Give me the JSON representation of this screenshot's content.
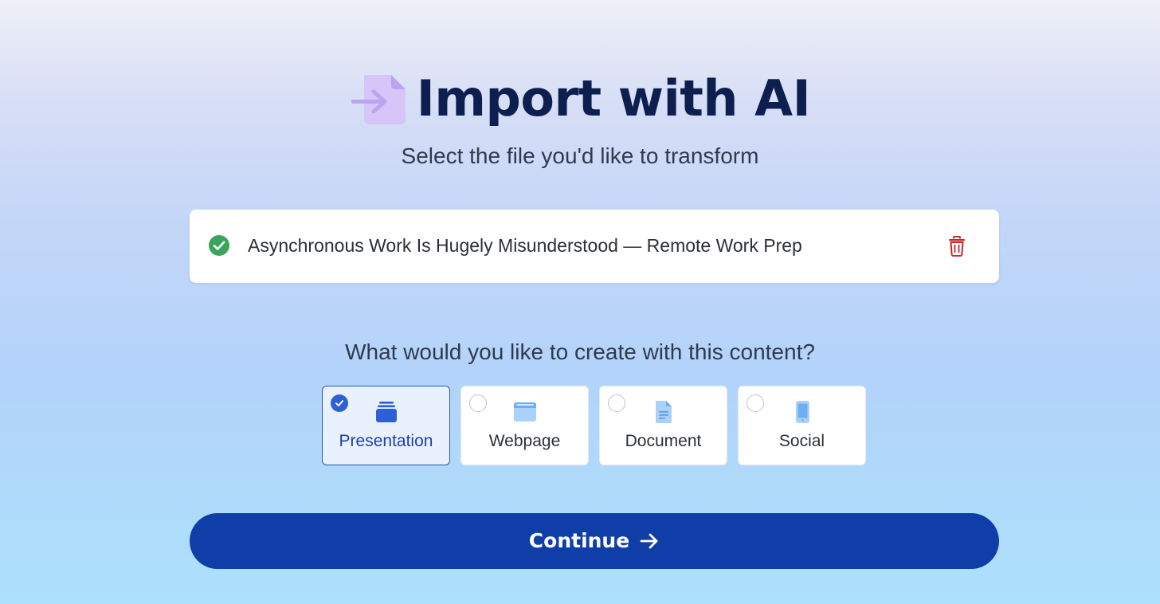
{
  "header": {
    "title": "Import with AI",
    "subtitle": "Select the file you'd like to transform",
    "icon": "file-import-icon"
  },
  "file": {
    "name": "Asynchronous Work Is Hugely Misunderstood — Remote Work Prep",
    "status": "uploaded",
    "status_icon": "check-circle-icon",
    "delete_icon": "trash-icon"
  },
  "create": {
    "question": "What would you like to create with this content?",
    "options": [
      {
        "label": "Presentation",
        "icon": "presentation-icon",
        "selected": true
      },
      {
        "label": "Webpage",
        "icon": "webpage-icon",
        "selected": false
      },
      {
        "label": "Document",
        "icon": "document-icon",
        "selected": false
      },
      {
        "label": "Social",
        "icon": "mobile-icon",
        "selected": false
      }
    ]
  },
  "actions": {
    "continue_label": "Continue",
    "continue_icon": "arrow-right-icon"
  },
  "colors": {
    "title": "#0c1f4f",
    "accent": "#0f3ea8",
    "selected_border": "#2d55b5",
    "success": "#3aa55a",
    "danger": "#c42b2b",
    "icon_purple": "#c9b3f5"
  }
}
